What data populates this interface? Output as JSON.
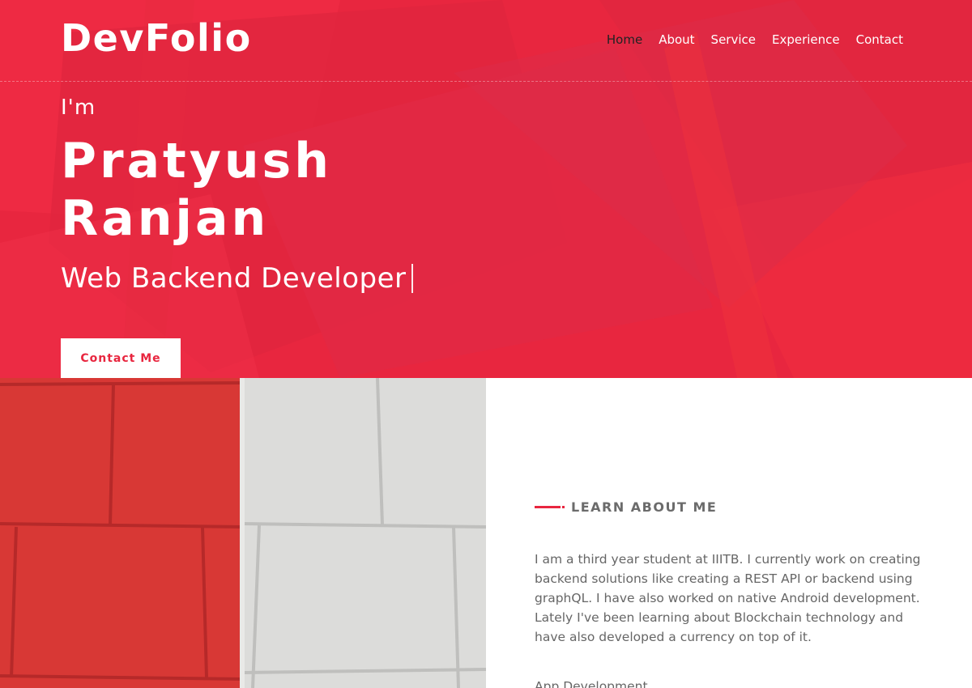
{
  "brand": "DevFolio",
  "nav": {
    "items": [
      {
        "label": "Home",
        "active": true
      },
      {
        "label": "About",
        "active": false
      },
      {
        "label": "Service",
        "active": false
      },
      {
        "label": "Experience",
        "active": false
      },
      {
        "label": "Contact",
        "active": false
      }
    ]
  },
  "hero": {
    "greeting": "I'm",
    "name_line1": "Pratyush",
    "name_line2": "Ranjan",
    "role": "Web Backend Developer",
    "cta_label": "Contact Me"
  },
  "about": {
    "section_title": "LEARN ABOUT ME",
    "paragraph": "I am a third year student at IIITB. I currently work on creating backend solutions like creating a REST API or backend using graphQL. I have also worked on native Android development. Lately I've been learning about Blockchain technology and have also developed a currency on top of it.",
    "skill_label": "App Development"
  },
  "colors": {
    "accent": "#e8263f",
    "nav_active": "#222222",
    "text_muted": "#666666"
  }
}
